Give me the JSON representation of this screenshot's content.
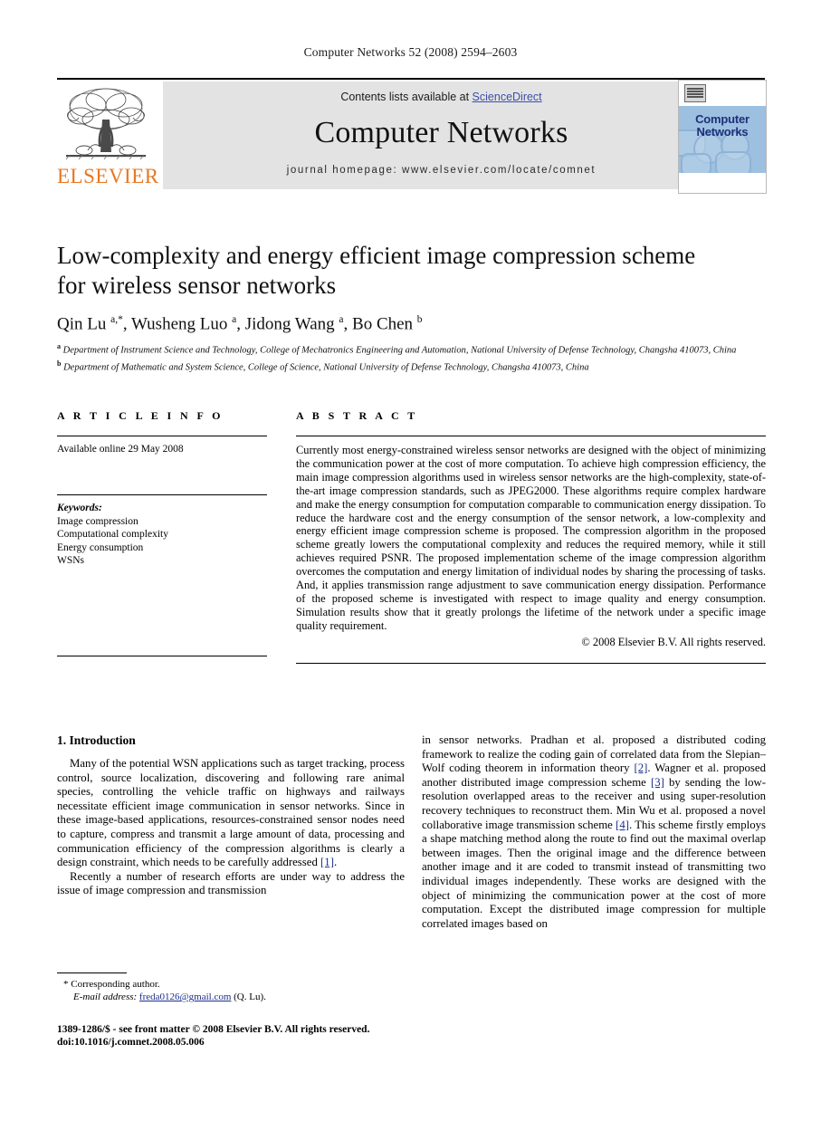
{
  "running_head": "Computer Networks 52 (2008) 2594–2603",
  "masthead": {
    "publisher_name": "ELSEVIER",
    "contents_prefix": "Contents lists available at ",
    "contents_link": "ScienceDirect",
    "journal_name": "Computer Networks",
    "homepage": "journal homepage: www.elsevier.com/locate/comnet",
    "cover": {
      "title_line1": "Computer",
      "title_line2": "Networks"
    },
    "link_color": "#3d4ea8",
    "brand_color": "#e87722"
  },
  "article": {
    "title": "Low-complexity and energy efficient image compression scheme for wireless sensor networks",
    "authors": "Qin Lu a,*, Wusheng Luo a, Jidong Wang a, Bo Chen b",
    "affiliation_a": "a Department of Instrument Science and Technology, College of Mechatronics Engineering and Automation, National University of Defense Technology, Changsha 410073, China",
    "affiliation_b": "b Department of Mathematic and System Science, College of Science, National University of Defense Technology, Changsha 410073, China"
  },
  "article_info": {
    "heading": "A R T I C L E   I N F O",
    "available_online": "Available online 29 May 2008",
    "keywords_label": "Keywords:",
    "keywords": [
      "Image compression",
      "Computational complexity",
      "Energy consumption",
      "WSNs"
    ]
  },
  "abstract": {
    "heading": "A B S T R A C T",
    "body": "Currently most energy-constrained wireless sensor networks are designed with the object of minimizing the communication power at the cost of more computation. To achieve high compression efficiency, the main image compression algorithms used in wireless sensor networks are the high-complexity, state-of-the-art image compression standards, such as JPEG2000. These algorithms require complex hardware and make the energy consumption for computation comparable to communication energy dissipation. To reduce the hardware cost and the energy consumption of the sensor network, a low-complexity and energy efficient image compression scheme is proposed. The compression algorithm in the proposed scheme greatly lowers the computational complexity and reduces the required memory, while it still achieves required PSNR. The proposed implementation scheme of the image compression algorithm overcomes the computation and energy limitation of individual nodes by sharing the processing of tasks. And, it applies transmission range adjustment to save communication energy dissipation. Performance of the proposed scheme is investigated with respect to image quality and energy consumption. Simulation results show that it greatly prolongs the lifetime of the network under a specific image quality requirement.",
    "copyright": "© 2008 Elsevier B.V. All rights reserved."
  },
  "body": {
    "section_title": "1. Introduction",
    "left_p1": "Many of the potential WSN applications such as target tracking, process control, source localization, discovering and following rare animal species, controlling the vehicle traffic on highways and railways necessitate efficient image communication in sensor networks. Since in these image-based applications, resources-constrained sensor nodes need to capture, compress and transmit a large amount of data, processing and communication efficiency of the compression algorithms is clearly a design constraint, which needs to be carefully addressed ",
    "left_p1_ref": "[1]",
    "left_p1_end": ".",
    "left_p2": "Recently a number of research efforts are under way to address the issue of image compression and transmission",
    "right_part1": "in sensor networks. Pradhan et al. proposed a distributed coding framework to realize the coding gain of correlated data from the Slepian–Wolf coding theorem in information theory ",
    "right_ref1": "[2]",
    "right_part2": ". Wagner et al. proposed another distributed image compression scheme ",
    "right_ref2": "[3]",
    "right_part3": " by sending the low-resolution overlapped areas to the receiver and using super-resolution recovery techniques to reconstruct them. Min Wu et al. proposed a novel collaborative image transmission scheme ",
    "right_ref3": "[4]",
    "right_part4": ". This scheme firstly employs a shape matching method along the route to find out the maximal overlap between images. Then the original image and the difference between another image and it are coded to transmit instead of transmitting two individual images independently. These works are designed with the object of minimizing the communication power at the cost of more computation. Except the distributed image compression for multiple correlated images based on"
  },
  "footnote": {
    "corresponding": "Corresponding author.",
    "email_label": "E-mail address:",
    "email": "freda0126@gmail.com",
    "email_suffix": " (Q. Lu).",
    "imprint_line1": "1389-1286/$ - see front matter © 2008 Elsevier B.V. All rights reserved.",
    "imprint_line2": "doi:10.1016/j.comnet.2008.05.006"
  }
}
